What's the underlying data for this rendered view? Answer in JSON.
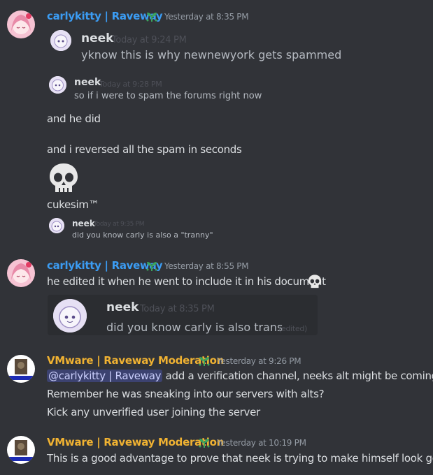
{
  "messages": [
    {
      "author": "carlykitty | Raveway",
      "timestamp": "Yesterday at 8:35 PM",
      "quotes": [
        {
          "author": "neek",
          "timestamp": "Today at 9:24 PM",
          "text": "yknow this is why newnewyork gets spammed"
        },
        {
          "author": "neek",
          "timestamp": "Today at 9:28 PM",
          "text": "so if i were to spam the forums right now"
        }
      ],
      "lines": [
        "and he did",
        "and i reversed all the spam in seconds",
        "cukesim™"
      ],
      "quote3": {
        "author": "neek",
        "timestamp": "Today at 9:35 PM",
        "text": "did you know carly is also a \"tranny\""
      }
    },
    {
      "author": "carlykitty | Raveway",
      "timestamp": "Yesterday at 8:55 PM",
      "text": "he edited it when he went to include it in his document",
      "embed": {
        "author": "neek",
        "timestamp": "Today at 8:35 PM",
        "text": "did you know carly is also trans",
        "edited": "(edited)"
      }
    },
    {
      "author": "VMware | Raveway Moderation",
      "timestamp": "Yesterday at 9:26 PM",
      "mention": "@carlykitty | Raveway",
      "line1_rest": "add a verification channel, neeks alt might be coming",
      "line2": "Remember he was sneaking into our servers with alts?",
      "line3": "Kick any unverified user joining the server"
    },
    {
      "author": "VMware | Raveway Moderation",
      "timestamp": "Yesterday at 10:19 PM",
      "text": "This is a good advantage to prove that neek is trying to make himself look good"
    }
  ],
  "colors": {
    "carly": "#3b9cf3",
    "vmware": "#f0b232",
    "background": "#313338"
  }
}
